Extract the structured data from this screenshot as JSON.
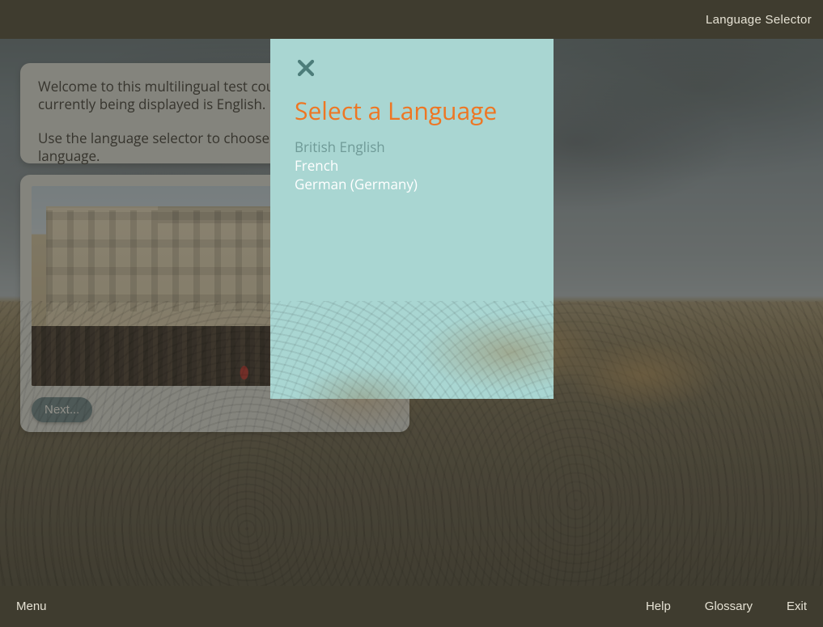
{
  "topbar": {
    "title": "Language Selector"
  },
  "intro": {
    "line1": "Welcome to this multilingual test course. The language currently being displayed is English.",
    "line2": "Use the language selector to choose your preferred language."
  },
  "imageCard": {
    "next_label": "Next...",
    "image_name": "buckingham-palace-parade"
  },
  "modal": {
    "title": "Select a Language",
    "options": [
      {
        "label": "British English",
        "selected": true
      },
      {
        "label": "French",
        "selected": false
      },
      {
        "label": "German (Germany)",
        "selected": false
      }
    ]
  },
  "bottombar": {
    "menu": "Menu",
    "help": "Help",
    "glossary": "Glossary",
    "exit": "Exit"
  }
}
